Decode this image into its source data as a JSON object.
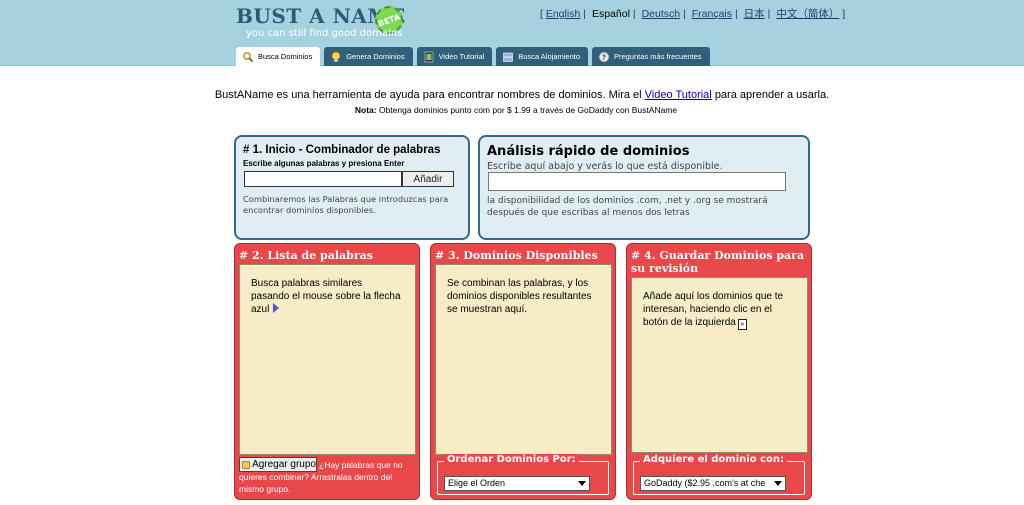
{
  "header": {
    "logo_title": "BUST A NAME",
    "logo_badge": "BETA",
    "logo_tagline": "you can still find good domains",
    "languages": [
      {
        "label": "English",
        "current": false
      },
      {
        "label": "Español",
        "current": true
      },
      {
        "label": "Deutsch",
        "current": false
      },
      {
        "label": "Français",
        "current": false
      },
      {
        "label": "日本",
        "current": false
      },
      {
        "label": "中文（简体）",
        "current": false
      }
    ],
    "lang_open": "[",
    "lang_close": "]",
    "tabs": [
      {
        "label": "Busca Dominios",
        "icon": "magnifier-icon",
        "active": true
      },
      {
        "label": "Genera Dominios",
        "icon": "lightbulb-icon",
        "active": false
      },
      {
        "label": "Video Tutorial",
        "icon": "film-icon",
        "active": false
      },
      {
        "label": "Busca Alojamiento",
        "icon": "server-icon",
        "active": false
      },
      {
        "label": "Preguntas más frecuentes",
        "icon": "help-icon",
        "active": false
      }
    ]
  },
  "intro": {
    "before_link": "BustAName es una herramienta de ayuda para encontrar nombres de dominios. Mira el",
    "link": "Video Tutorial",
    "after_link": "para aprender a usarla.",
    "note_label": "Nota:",
    "note_text": "Obtenga dominios punto com por $ 1.99 a través de GoDaddy con BustAName"
  },
  "box1": {
    "title": "# 1. Inicio - Combinador de palabras",
    "subtitle": "Escribe algunas palabras y presiona Enter",
    "input_value": "",
    "button_label": "Añadir",
    "description": "Combinaremos las Palabras que introduzcas para encontrar dominios disponibles."
  },
  "box2": {
    "title": "Análisis rápido de dominios",
    "subtitle": "Escribe aquí abajo y verás lo que está disponible.",
    "input_value": "",
    "description": "la disponibilidad de los dominios .com, .net y .org se mostrará después de que escribas al menos dos letras"
  },
  "list_box": {
    "title": "# 2. Lista de palabras",
    "text": "Busca palabras similares pasando el mouse sobre la flecha azul",
    "button_label": "Agregar grupo",
    "footer": "¿Hay palabras que no quieres combinar? Arrastralas dentro del mismo grupo."
  },
  "available_box": {
    "title": "# 3. Dominios Disponibles",
    "text": "Se combinan las palabras, y los dominios disponibles resultantes se muestran aquí.",
    "legend": "Ordenar Dominios Por:",
    "select_value": "Elige el Orden"
  },
  "save_box": {
    "title": "# 4. Guardar Dominios para su revisión",
    "text": "Añade aquí los dominios que te interesan, haciendo clic en el botón de la izquierda",
    "icon_glyph": "»",
    "legend": "Adquiere el dominio con:",
    "select_value": "GoDaddy ($2.95 .com's at che"
  },
  "colors": {
    "header_bg": "#a6d2e0",
    "tab_bg": "#2f5f7a",
    "blue_box_border": "#2f6a89",
    "red_box_bg": "#e8484a",
    "panel_bg": "#f6ecc6"
  }
}
